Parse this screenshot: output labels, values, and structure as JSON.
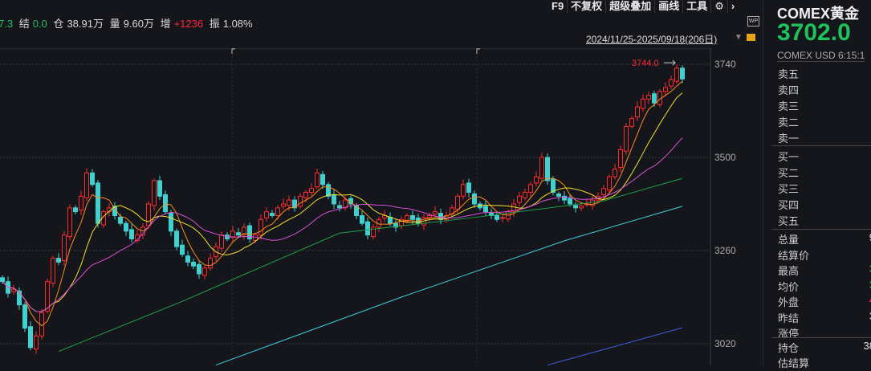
{
  "quote": {
    "last_tail": "7.3",
    "settle_label": "结",
    "settle": "0.0",
    "oi_label": "仓",
    "oi": "38.91万",
    "vol_label": "量",
    "vol": "9.60万",
    "inc_label": "增",
    "inc": "+1236",
    "amp_label": "振",
    "amp": "1.08%"
  },
  "toolbar": [
    "F9",
    "不复权",
    "超级叠加",
    "画线",
    "工具"
  ],
  "toolbar_icons": [
    "gear-icon",
    "chevron-right-icon"
  ],
  "range": "2024/11/25-2025/09/18(206日)",
  "wp_label": "WP",
  "side": {
    "title": "COMEX黄金",
    "price": "3702.0",
    "sub": "COMEX  USD  6:15:1",
    "asks": [
      "卖五",
      "卖四",
      "卖三",
      "卖二",
      "卖一"
    ],
    "bids": [
      "买一",
      "买二",
      "买三",
      "买四",
      "买五"
    ],
    "stats": [
      {
        "l": "总量",
        "v": "9",
        "c": "w"
      },
      {
        "l": "结算价",
        "v": "",
        "c": "w"
      },
      {
        "l": "最高",
        "v": "3",
        "c": "g"
      },
      {
        "l": "均价",
        "v": "3",
        "c": "g"
      },
      {
        "l": "外盘",
        "v": "4",
        "c": "r"
      },
      {
        "l": "昨结",
        "v": "3",
        "c": "w"
      },
      {
        "l": "涨停",
        "v": "",
        "c": "w"
      }
    ],
    "stats2": [
      {
        "l": "持仓",
        "v": "38",
        "c": "w"
      },
      {
        "l": "估结算",
        "v": "",
        "c": "w"
      }
    ]
  },
  "chart_data": {
    "type": "candlestick",
    "yticks": [
      3740,
      3500,
      3260,
      3020
    ],
    "ylim": [
      2965,
      3780
    ],
    "max_label": "3744.0",
    "max_value": 3744,
    "closes": [
      3180,
      3150,
      3160,
      3120,
      3060,
      3010,
      3040,
      3100,
      3180,
      3240,
      3230,
      3300,
      3370,
      3360,
      3400,
      3460,
      3430,
      3330,
      3360,
      3370,
      3350,
      3330,
      3310,
      3290,
      3300,
      3320,
      3380,
      3440,
      3400,
      3360,
      3310,
      3270,
      3250,
      3230,
      3220,
      3200,
      3215,
      3240,
      3270,
      3300,
      3290,
      3310,
      3300,
      3320,
      3290,
      3300,
      3340,
      3360,
      3350,
      3370,
      3380,
      3390,
      3370,
      3400,
      3410,
      3420,
      3460,
      3430,
      3400,
      3380,
      3370,
      3390,
      3380,
      3350,
      3330,
      3300,
      3320,
      3340,
      3350,
      3330,
      3320,
      3340,
      3350,
      3340,
      3330,
      3345,
      3350,
      3360,
      3340,
      3350,
      3370,
      3400,
      3430,
      3410,
      3380,
      3370,
      3360,
      3350,
      3340,
      3345,
      3360,
      3380,
      3400,
      3410,
      3430,
      3450,
      3500,
      3440,
      3410,
      3400,
      3390,
      3380,
      3370,
      3375,
      3380,
      3390,
      3400,
      3420,
      3450,
      3470,
      3520,
      3580,
      3600,
      3630,
      3650,
      3660,
      3640,
      3670,
      3680,
      3700,
      3730,
      3702
    ],
    "ma": [
      {
        "name": "MA5",
        "period": 5,
        "color": "#ff8c1a"
      },
      {
        "name": "MA10",
        "period": 10,
        "color": "#f5e12a"
      },
      {
        "name": "MA20",
        "period": 20,
        "color": "#d84fd8"
      }
    ],
    "long_ma": [
      {
        "name": "MA60",
        "color": "#1f9e4a",
        "points": [
          [
            10,
            3000
          ],
          [
            32,
            3129
          ],
          [
            60,
            3305
          ],
          [
            85,
            3347
          ],
          [
            107,
            3388
          ],
          [
            121,
            3446
          ]
        ]
      },
      {
        "name": "MA120",
        "color": "#3fd0e0",
        "points": [
          [
            38,
            2965
          ],
          [
            71,
            3140
          ],
          [
            100,
            3285
          ],
          [
            121,
            3374
          ]
        ]
      },
      {
        "name": "MA250",
        "color": "#3a5fe0",
        "points": [
          [
            97,
            2965
          ],
          [
            121,
            3061
          ]
        ]
      }
    ],
    "up_color": "#ff2a2a",
    "down_color": "#3fd0d0"
  }
}
